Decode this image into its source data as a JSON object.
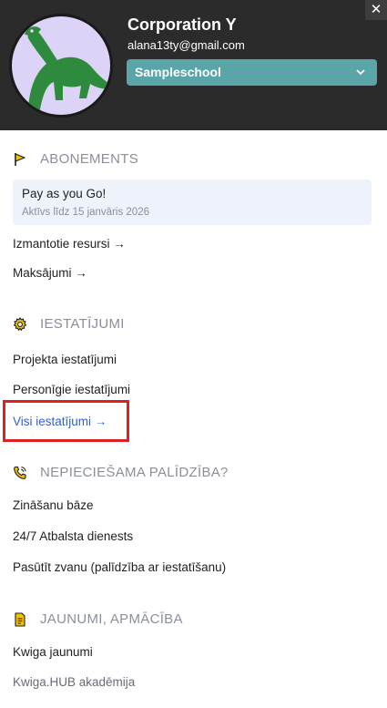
{
  "header": {
    "company": "Corporation Y",
    "email": "alana13ty@gmail.com",
    "school": "Sampleschool",
    "close_label": "✕"
  },
  "subscription": {
    "title": "ABONEMENTS",
    "plan_name": "Pay as you Go!",
    "plan_status": "Aktīvs līdz 15 janvāris 2026",
    "used_resources": "Izmantotie resursi →",
    "payments": "Maksājumi →"
  },
  "settings": {
    "title": "IESTATĪJUMI",
    "project": "Projekta iestatījumi",
    "personal": "Personīgie iestatījumi",
    "all": "Visi iestatījumi  →"
  },
  "help": {
    "title": "NEPIECIEŠAMA PALĪDZĪBA?",
    "knowledge_base": "Zināšanu bāze",
    "support": "24/7 Atbalsta dienests",
    "order_call": "Pasūtīt zvanu (palīdzība ar iestatīšanu)"
  },
  "news": {
    "title": "JAUNUMI, APMĀCĪBA",
    "kwiga_news": "Kwiga jaunumi",
    "academy": "Kwiga.HUB akadēmija"
  },
  "colors": {
    "header_bg": "#2b2b2b",
    "select_bg": "#5aa5a8",
    "avatar_bg": "#dcd3f7",
    "dino": "#2e8b3e",
    "icon_yellow": "#f2c200",
    "link_blue": "#2f5fd6",
    "highlight_red": "#e02020"
  }
}
